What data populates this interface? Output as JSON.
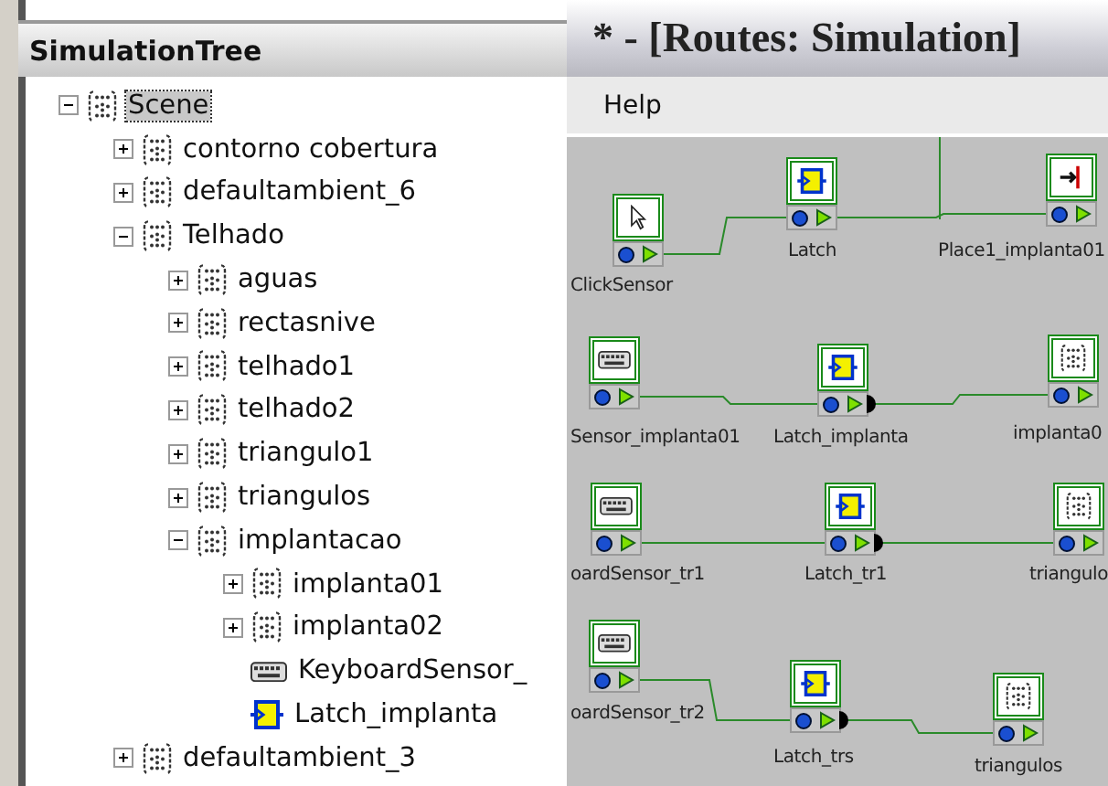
{
  "tree": {
    "title": "SimulationTree",
    "items": [
      {
        "label": "Scene",
        "kind": "group",
        "expanded": true,
        "selected": true,
        "children": [
          {
            "label": "contorno cobertura",
            "kind": "group",
            "expanded": false,
            "selected": false
          },
          {
            "label": "defaultambient_6",
            "kind": "group",
            "expanded": false,
            "selected": false
          },
          {
            "label": "Telhado",
            "kind": "group",
            "expanded": true,
            "selected": false,
            "children": [
              {
                "label": "aguas",
                "kind": "group",
                "expanded": false,
                "selected": false
              },
              {
                "label": "rectasnive",
                "kind": "group",
                "expanded": false,
                "selected": false
              },
              {
                "label": "telhado1",
                "kind": "group",
                "expanded": false,
                "selected": false
              },
              {
                "label": "telhado2",
                "kind": "group",
                "expanded": false,
                "selected": false
              },
              {
                "label": "triangulo1",
                "kind": "group",
                "expanded": false,
                "selected": false
              },
              {
                "label": "triangulos",
                "kind": "group",
                "expanded": false,
                "selected": false
              },
              {
                "label": "implantacao",
                "kind": "group",
                "expanded": true,
                "selected": false,
                "children": [
                  {
                    "label": "implanta01",
                    "kind": "group",
                    "expanded": false,
                    "selected": false
                  },
                  {
                    "label": "implanta02",
                    "kind": "group",
                    "expanded": false,
                    "selected": false
                  },
                  {
                    "label": "KeyboardSensor_",
                    "kind": "keyboard",
                    "selected": false
                  },
                  {
                    "label": "Latch_implanta",
                    "kind": "latch",
                    "selected": false
                  }
                ]
              }
            ]
          },
          {
            "label": "defaultambient_3",
            "kind": "group",
            "expanded": false,
            "selected": false
          }
        ]
      }
    ]
  },
  "routes": {
    "title": "* - [Routes: Simulation]",
    "menu": [
      "Help"
    ],
    "nodes": [
      {
        "label": "ClickSensor",
        "kind": "click",
        "event_out": false
      },
      {
        "label": "Latch",
        "kind": "latch",
        "event_out": false
      },
      {
        "label": "Place1_implanta01",
        "kind": "place",
        "event_out": false
      },
      {
        "label": "Sensor_implanta01",
        "kind": "keyboard",
        "event_out": false
      },
      {
        "label": "Latch_implanta",
        "kind": "latch",
        "event_out": true
      },
      {
        "label": "implanta0",
        "kind": "group",
        "event_out": false
      },
      {
        "label": "oardSensor_tr1",
        "kind": "keyboard",
        "event_out": false
      },
      {
        "label": "Latch_tr1",
        "kind": "latch",
        "event_out": true
      },
      {
        "label": "triangulo",
        "kind": "group",
        "event_out": false
      },
      {
        "label": "oardSensor_tr2",
        "kind": "keyboard",
        "event_out": false
      },
      {
        "label": "Latch_trs",
        "kind": "latch",
        "event_out": true
      },
      {
        "label": "triangulos",
        "kind": "group",
        "event_out": false
      }
    ]
  }
}
